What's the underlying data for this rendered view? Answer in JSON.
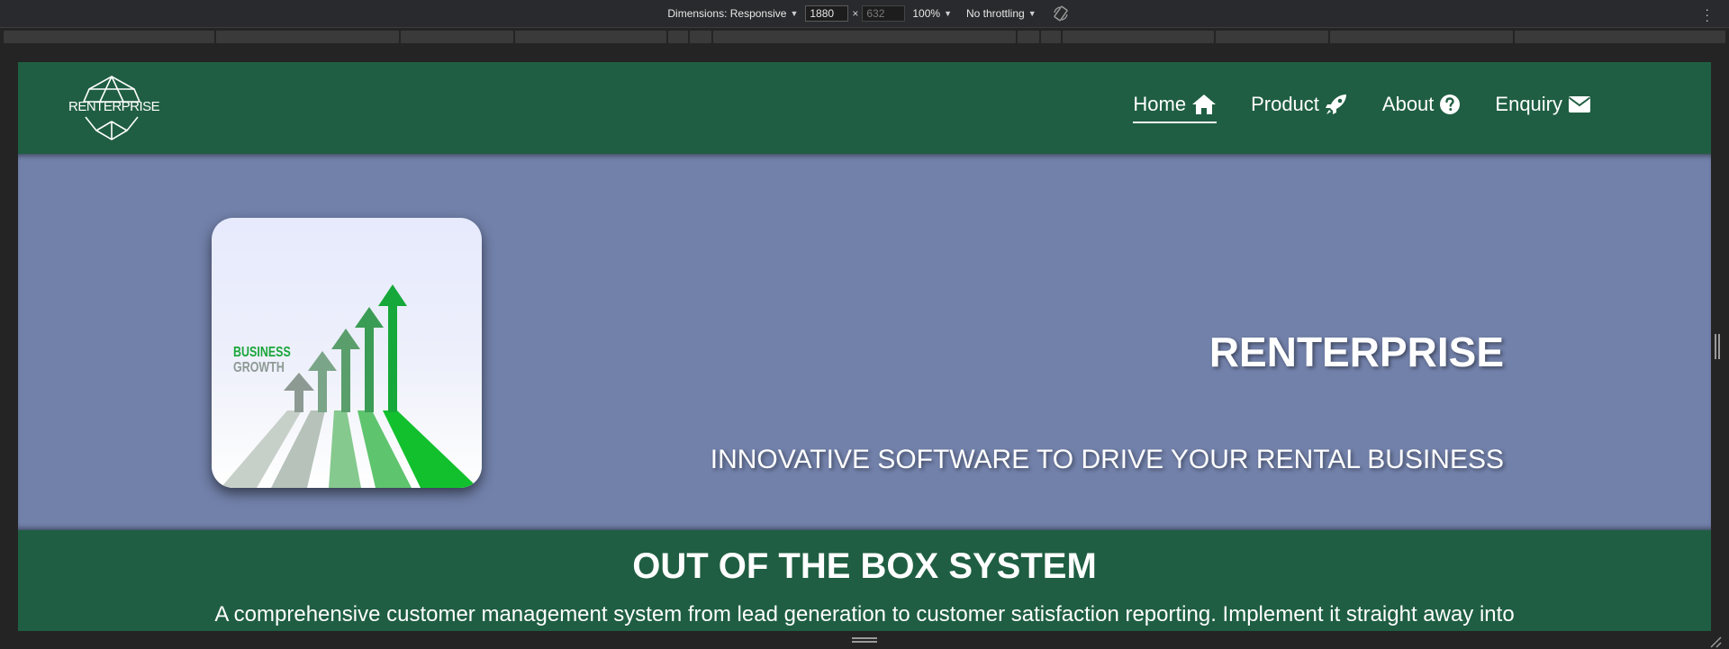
{
  "devtools": {
    "dimensions_label": "Dimensions: Responsive",
    "width_value": "1880",
    "height_value": "632",
    "zoom_label": "100%",
    "throttling_label": "No throttling",
    "times_glyph": "×"
  },
  "site": {
    "logo_text": "RENTERPRISE",
    "nav": [
      {
        "label": "Home",
        "icon": "home-icon"
      },
      {
        "label": "Product",
        "icon": "rocket-icon"
      },
      {
        "label": "About",
        "icon": "question-circle-icon"
      },
      {
        "label": "Enquiry",
        "icon": "envelope-icon"
      }
    ],
    "hero": {
      "image_text_1": "BUSINESS",
      "image_text_2": "GROWTH",
      "title": "RENTERPRISE",
      "subtitle": "INNOVATIVE SOFTWARE TO DRIVE YOUR RENTAL BUSINESS"
    },
    "section": {
      "title": "OUT OF THE BOX SYSTEM",
      "text": "A comprehensive customer management system from lead generation to customer satisfaction reporting. Implement it straight away into"
    }
  },
  "colors": {
    "brand_green": "#1f5e42",
    "hero_blue": "#7281aa",
    "arrow_green": "#1aa63a"
  }
}
